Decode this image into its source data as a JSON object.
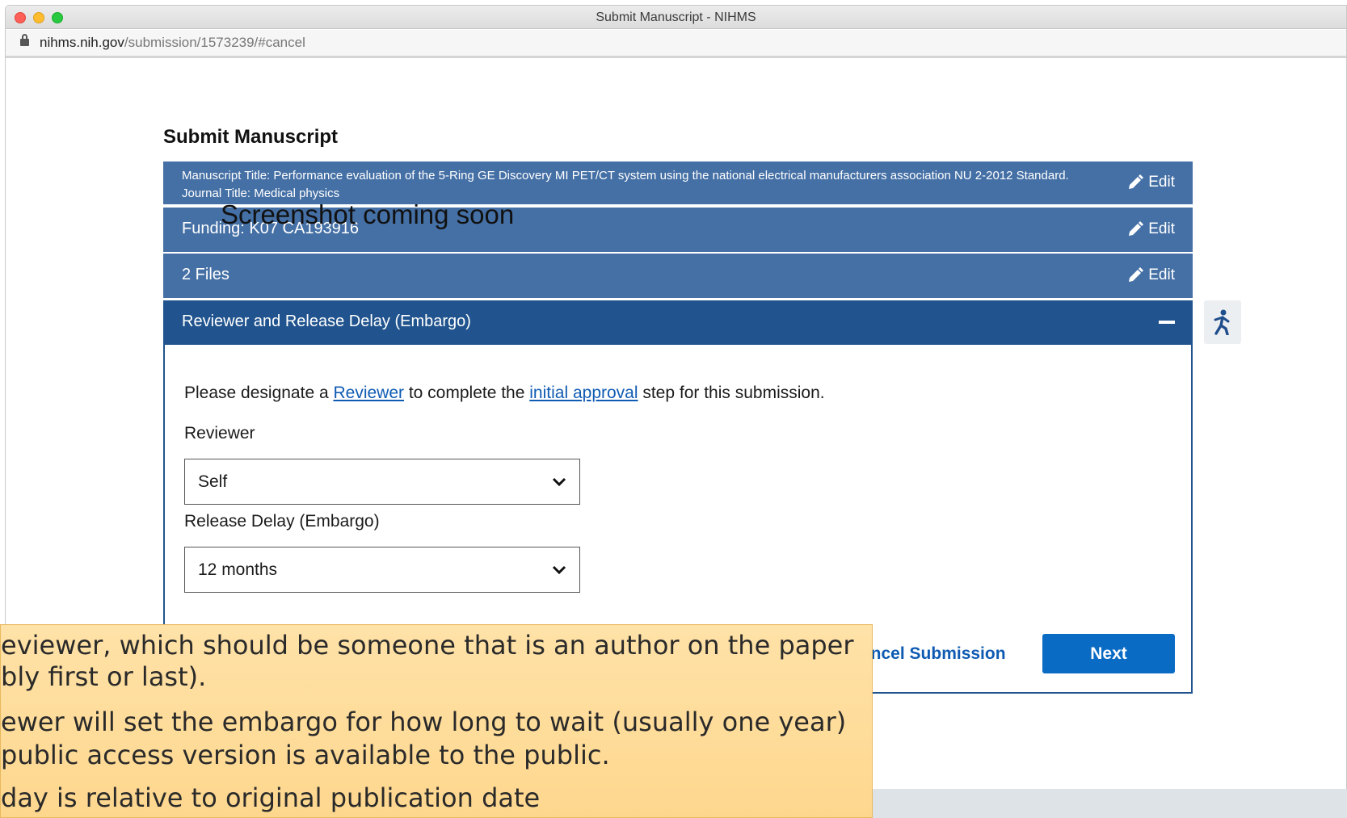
{
  "window": {
    "title": "Submit Manuscript - NIHMS"
  },
  "url": {
    "host": "nihms.nih.gov",
    "path": "/submission/1573239/#cancel"
  },
  "page": {
    "title": "Submit Manuscript"
  },
  "overlay": {
    "text": "Screenshot coming soon"
  },
  "sections": {
    "manuscript": {
      "line1": "Manuscript Title: Performance evaluation of the 5-Ring GE Discovery MI PET/CT system using the national electrical manufacturers association NU 2-2012 Standard.",
      "line2": "Journal Title: Medical physics",
      "edit": "Edit"
    },
    "funding": {
      "label": "Funding: K07 CA193916",
      "edit": "Edit"
    },
    "files": {
      "label": "2 Files",
      "edit": "Edit"
    },
    "reviewer": {
      "label": "Reviewer and Release Delay (Embargo)"
    }
  },
  "panel": {
    "intro_before": "Please designate a ",
    "intro_link1": "Reviewer",
    "intro_middle": " to complete the ",
    "intro_link2": "initial approval",
    "intro_after": " step for this submission.",
    "reviewer_label": "Reviewer",
    "reviewer_value": "Self",
    "embargo_label": "Release Delay (Embargo)",
    "embargo_value": "12 months",
    "cancel": "ancel Submission",
    "next": "Next"
  },
  "callout": {
    "line1": "eviewer, which should be someone that is an author on the paper",
    "line2": "bly first or last).",
    "line3": "ewer will set the embargo for how long to wait (usually one year)",
    "line4": " public access version is available to the public.",
    "line5": "day is relative to original publication date"
  }
}
